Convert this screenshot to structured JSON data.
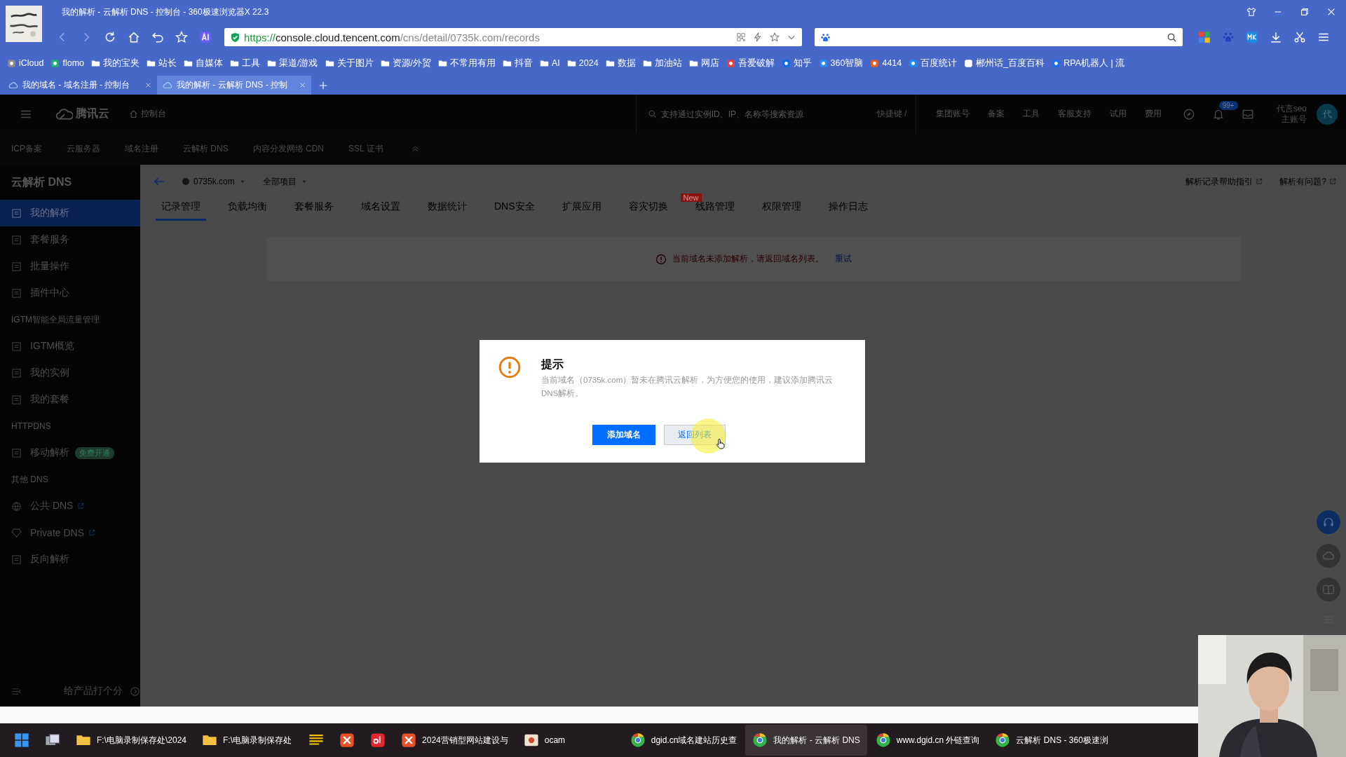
{
  "browser": {
    "title": "我的解析 - 云解析 DNS - 控制台 - 360极速浏览器X 22.3",
    "url": {
      "scheme": "https://",
      "host": "console.cloud.tencent.com",
      "path": "/cns/detail/0735k.com/records"
    },
    "bookmarks": [
      {
        "label": "iCloud",
        "kind": "site"
      },
      {
        "label": "flomo",
        "kind": "site"
      },
      {
        "label": "我的宝夹",
        "kind": "folder"
      },
      {
        "label": "站长",
        "kind": "folder"
      },
      {
        "label": "自媒体",
        "kind": "folder"
      },
      {
        "label": "工具",
        "kind": "folder"
      },
      {
        "label": "渠道/游戏",
        "kind": "folder"
      },
      {
        "label": "关于图片",
        "kind": "folder"
      },
      {
        "label": "资源/外贸",
        "kind": "folder"
      },
      {
        "label": "不常用有用",
        "kind": "folder"
      },
      {
        "label": "抖音",
        "kind": "folder"
      },
      {
        "label": "AI",
        "kind": "folder"
      },
      {
        "label": "2024",
        "kind": "folder"
      },
      {
        "label": "数据",
        "kind": "folder"
      },
      {
        "label": "加油站",
        "kind": "folder"
      },
      {
        "label": "网店",
        "kind": "folder"
      },
      {
        "label": "吾爱破解",
        "kind": "site"
      },
      {
        "label": "知乎",
        "kind": "site"
      },
      {
        "label": "360智脑",
        "kind": "site"
      },
      {
        "label": "4414",
        "kind": "site"
      },
      {
        "label": "百度统计",
        "kind": "site"
      },
      {
        "label": "郴州话_百度百科",
        "kind": "site"
      },
      {
        "label": "RPA机器人 | 流",
        "kind": "site"
      }
    ],
    "tabs": [
      {
        "label": "我的域名 - 域名注册 - 控制台",
        "selected": false
      },
      {
        "label": "我的解析 - 云解析 DNS - 控制",
        "selected": true
      }
    ]
  },
  "console": {
    "brand": "腾讯云",
    "home": "控制台",
    "search": {
      "placeholder": "支持通过实例ID、IP、名称等搜索资源"
    },
    "shortcut": "快捷键 /",
    "links": [
      "集团账号",
      "备案",
      "工具",
      "客服支持",
      "试用",
      "费用"
    ],
    "notifications": "99+",
    "account": {
      "name": "代言seo",
      "role": "主账号",
      "avatar": "代"
    },
    "products": [
      "ICP备案",
      "云服务器",
      "域名注册",
      "云解析 DNS",
      "内容分发网络 CDN",
      "SSL 证书"
    ]
  },
  "sidebar": {
    "title": "云解析 DNS",
    "groups": [
      {
        "items": [
          {
            "label": "我的解析",
            "selected": true,
            "external": false
          },
          {
            "label": "套餐服务",
            "selected": false,
            "external": false
          },
          {
            "label": "批量操作",
            "selected": false,
            "external": false
          },
          {
            "label": "插件中心",
            "selected": false,
            "external": false
          }
        ]
      },
      {
        "heading": "IGTM智能全局流量管理",
        "items": [
          {
            "label": "IGTM概览",
            "selected": false,
            "external": false
          },
          {
            "label": "我的实例",
            "selected": false,
            "external": false
          },
          {
            "label": "我的套餐",
            "selected": false,
            "external": false
          }
        ]
      },
      {
        "heading": "HTTPDNS",
        "items": [
          {
            "label": "移动解析",
            "selected": false,
            "external": false,
            "badge": "免费开通"
          }
        ]
      },
      {
        "heading": "其他 DNS",
        "items": [
          {
            "label": "公共 DNS",
            "selected": false,
            "external": true
          },
          {
            "label": "Private DNS",
            "selected": false,
            "external": true
          },
          {
            "label": "反向解析",
            "selected": false,
            "external": false
          }
        ]
      }
    ],
    "footer": "给产品打个分"
  },
  "content": {
    "domain": "0735k.com",
    "project": "全部项目",
    "help_links": [
      "解析记录帮助指引",
      "解析有问题?"
    ],
    "tabs": [
      {
        "label": "记录管理",
        "selected": true
      },
      {
        "label": "负载均衡",
        "selected": false
      },
      {
        "label": "套餐服务",
        "selected": false
      },
      {
        "label": "域名设置",
        "selected": false
      },
      {
        "label": "数据统计",
        "selected": false
      },
      {
        "label": "DNS安全",
        "selected": false
      },
      {
        "label": "扩展应用",
        "selected": false
      },
      {
        "label": "容灾切换",
        "selected": false,
        "badge": "New"
      },
      {
        "label": "线路管理",
        "selected": false
      },
      {
        "label": "权限管理",
        "selected": false
      },
      {
        "label": "操作日志",
        "selected": false
      }
    ],
    "error": {
      "message": "当前域名未添加解析，请返回域名列表。",
      "action": "重试"
    }
  },
  "dialog": {
    "title": "提示",
    "message": "当前域名（0735k.com）暂未在腾讯云解析，为方便您的使用，建议添加腾讯云DNS解析。",
    "buttons": [
      {
        "label": "添加域名",
        "kind": "primary"
      },
      {
        "label": "返回列表",
        "kind": "secondary"
      }
    ]
  },
  "taskbar": {
    "items": [
      {
        "kind": "start",
        "selected": false
      },
      {
        "kind": "taskview",
        "selected": false
      },
      {
        "kind": "folder",
        "label": "F:\\电脑录制保存处\\2024",
        "selected": false
      },
      {
        "kind": "folder",
        "label": "F:\\电脑录制保存处",
        "selected": false
      },
      {
        "kind": "notes",
        "selected": false
      },
      {
        "kind": "wps",
        "selected": false
      },
      {
        "kind": "youdao",
        "selected": false
      },
      {
        "kind": "wps",
        "label": "2024营销型网站建设与",
        "selected": false
      },
      {
        "kind": "ocam",
        "label": "ocam",
        "selected": false
      },
      {
        "kind": "browser",
        "label": "dgid.cn域名建站历史查",
        "selected": false
      },
      {
        "kind": "browser",
        "label": "我的解析 - 云解析 DNS",
        "selected": true
      },
      {
        "kind": "browser",
        "label": "www.dgid.cn 外链查询",
        "selected": false
      },
      {
        "kind": "browser",
        "label": "云解析 DNS - 360极速浏",
        "selected": false
      }
    ]
  }
}
